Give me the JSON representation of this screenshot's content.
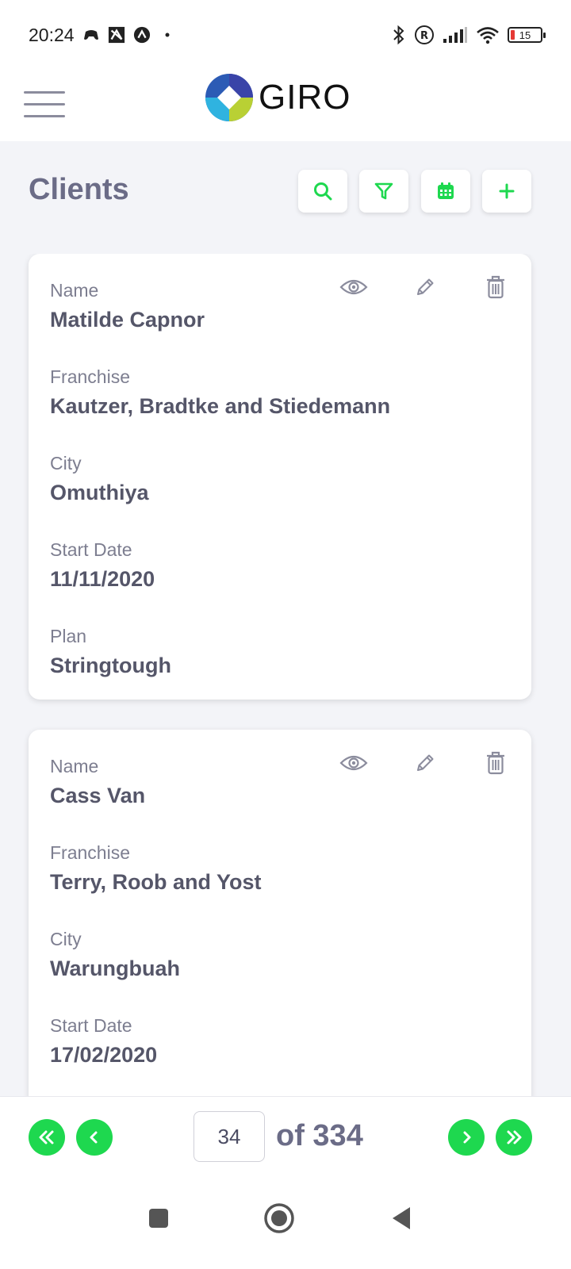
{
  "status_bar": {
    "time": "20:24",
    "battery": "15",
    "icons_left": [
      "game-controller-icon",
      "app-notification-icon",
      "app-badge-icon",
      "dot-icon"
    ],
    "icons_right": [
      "bluetooth-icon",
      "registered-icon",
      "signal-icon",
      "wifi-icon",
      "battery-icon"
    ]
  },
  "app_bar": {
    "logo_text": "GIRO"
  },
  "page": {
    "title": "Clients"
  },
  "toolbar": {
    "icons": [
      "search-icon",
      "filter-icon",
      "calendar-icon",
      "plus-icon"
    ],
    "accent_color": "#1ed84f"
  },
  "clients": [
    {
      "name_label": "Name",
      "name": "Matilde Capnor",
      "franchise_label": "Franchise",
      "franchise": "Kautzer, Bradtke and Stiedemann",
      "city_label": "City",
      "city": "Omuthiya",
      "start_label": "Start Date",
      "start": "11/11/2020",
      "plan_label": "Plan",
      "plan": "Stringtough"
    },
    {
      "name_label": "Name",
      "name": "Cass Van",
      "franchise_label": "Franchise",
      "franchise": "Terry, Roob and Yost",
      "city_label": "City",
      "city": "Warungbuah",
      "start_label": "Start Date",
      "start": "17/02/2020"
    }
  ],
  "card_actions": [
    "eye-icon",
    "pencil-icon",
    "trash-icon"
  ],
  "pagination": {
    "current_page": "34",
    "of_text": "of 334"
  },
  "nav_bar": {
    "icons": [
      "recents-icon",
      "home-icon",
      "back-icon"
    ]
  }
}
